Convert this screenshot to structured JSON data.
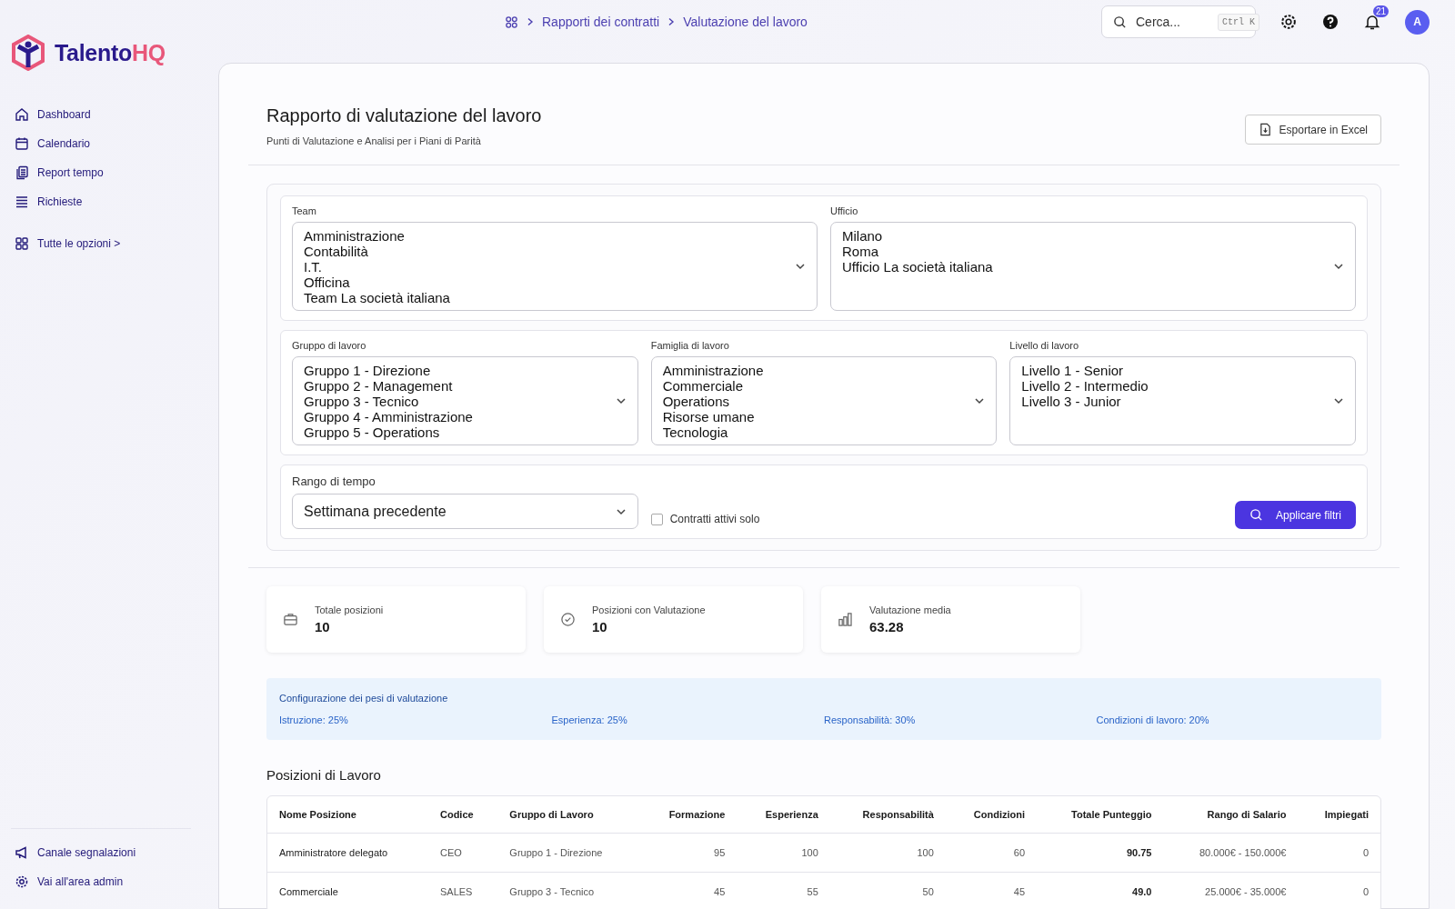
{
  "brand": {
    "name_main": "Talento",
    "name_accent": "HQ"
  },
  "sidebar": {
    "items": [
      {
        "label": "Dashboard"
      },
      {
        "label": "Calendario"
      },
      {
        "label": "Report tempo"
      },
      {
        "label": "Richieste"
      }
    ],
    "more": {
      "label": "Tutte le opzioni",
      "caret": ">"
    },
    "bottom_items": [
      {
        "label": "Canale segnalazioni"
      },
      {
        "label": "Vai all'area admin"
      }
    ]
  },
  "breadcrumbs": [
    "Rapporti dei contratti",
    "Valutazione del lavoro"
  ],
  "search": {
    "placeholder": "Cerca...",
    "shortcut": "Ctrl K"
  },
  "notifications": {
    "count": "21"
  },
  "avatar": {
    "initial": "A"
  },
  "page": {
    "title": "Rapporto di valutazione del lavoro",
    "subtitle": "Punti di Valutazione e Analisi per i Piani di Parità",
    "export_button": "Esportare in Excel"
  },
  "filters": {
    "row1": [
      {
        "label": "Team",
        "options": [
          "Amministrazione",
          "Contabilità",
          "I.T.",
          "Officina",
          "Team La società italiana"
        ]
      },
      {
        "label": "Ufficio",
        "options": [
          "Milano",
          "Roma",
          "Ufficio La società italiana"
        ]
      }
    ],
    "row2": [
      {
        "label": "Gruppo di lavoro",
        "options": [
          "Gruppo 1 - Direzione",
          "Gruppo 2 - Management",
          "Gruppo 3 - Tecnico",
          "Gruppo 4 - Amministrazione",
          "Gruppo 5 - Operations"
        ]
      },
      {
        "label": "Famiglia di lavoro",
        "options": [
          "Amministrazione",
          "Commerciale",
          "Operations",
          "Risorse umane",
          "Tecnologia"
        ]
      },
      {
        "label": "Livello di lavoro",
        "options": [
          "Livello 1 - Senior",
          "Livello 2 - Intermedio",
          "Livello 3 - Junior"
        ]
      }
    ],
    "time_range": {
      "label": "Rango di tempo",
      "value": "Settimana precedente"
    },
    "active_only": {
      "label": "Contratti attivi solo",
      "checked": false
    },
    "apply_button": "Applicare filtri"
  },
  "stats": [
    {
      "label": "Totale posizioni",
      "value": "10"
    },
    {
      "label": "Posizioni con Valutazione",
      "value": "10"
    },
    {
      "label": "Valutazione media",
      "value": "63.28"
    }
  ],
  "weights": {
    "title": "Configurazione dei pesi di valutazione",
    "items": [
      "Istruzione: 25%",
      "Esperienza: 25%",
      "Responsabilità: 30%",
      "Condizioni di lavoro: 20%"
    ]
  },
  "table": {
    "title": "Posizioni di Lavoro",
    "columns": [
      "Nome Posizione",
      "Codice",
      "Gruppo di Lavoro",
      "Formazione",
      "Esperienza",
      "Responsabilità",
      "Condizioni",
      "Totale Punteggio",
      "Rango di Salario",
      "Impiegati"
    ],
    "rows": [
      [
        "Amministratore delegato",
        "CEO",
        "Gruppo 1 - Direzione",
        "95",
        "100",
        "100",
        "60",
        "90.75",
        "80.000€ - 150.000€",
        "0"
      ],
      [
        "Commerciale",
        "SALES",
        "Gruppo 3 - Tecnico",
        "45",
        "55",
        "50",
        "45",
        "49.0",
        "25.000€ - 35.000€",
        "0"
      ]
    ]
  }
}
